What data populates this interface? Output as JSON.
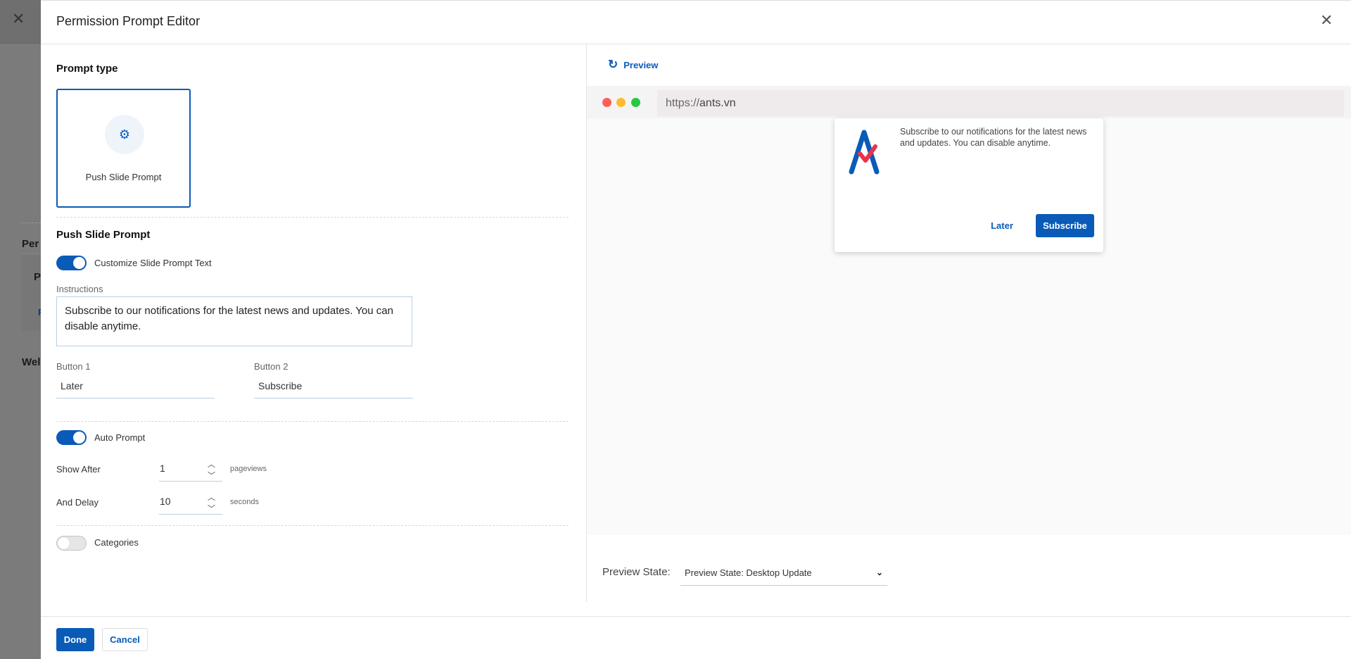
{
  "background": {
    "fragments": [
      "Per",
      "P",
      "F",
      "Wel"
    ]
  },
  "header": {
    "title": "Permission Prompt Editor"
  },
  "prompt_type": {
    "heading": "Prompt type",
    "selected_card": {
      "label": "Push Slide Prompt",
      "icon": "gear-icon"
    }
  },
  "push_slide": {
    "heading": "Push Slide Prompt",
    "customize_toggle": {
      "label": "Customize Slide Prompt Text",
      "on": true
    },
    "instructions_label": "Instructions",
    "instructions_value": "Subscribe to our notifications for the latest news and updates. You can disable anytime.",
    "button1_label": "Button 1",
    "button1_value": "Later",
    "button2_label": "Button 2",
    "button2_value": "Subscribe"
  },
  "auto_prompt": {
    "toggle_label": "Auto Prompt",
    "on": true,
    "show_after_label": "Show After",
    "show_after_value": "1",
    "show_after_unit": "pageviews",
    "delay_label": "And Delay",
    "delay_value": "10",
    "delay_unit": "seconds"
  },
  "categories": {
    "label": "Categories",
    "on": false
  },
  "footer": {
    "done": "Done",
    "cancel": "Cancel"
  },
  "preview": {
    "refresh_label": "Preview",
    "url_prefix": "https://",
    "url_host": "ants.vn",
    "popup_text": "Subscribe to our notifications for the latest news and updates. You can disable anytime.",
    "popup_later": "Later",
    "popup_subscribe": "Subscribe",
    "state_label": "Preview State:",
    "state_value": "Preview State: Desktop Update"
  },
  "colors": {
    "accent": "#0a5bb8",
    "logo_red": "#e8334a",
    "dot_red": "#fe5f57",
    "dot_yellow": "#febc2e",
    "dot_green": "#28c840"
  }
}
